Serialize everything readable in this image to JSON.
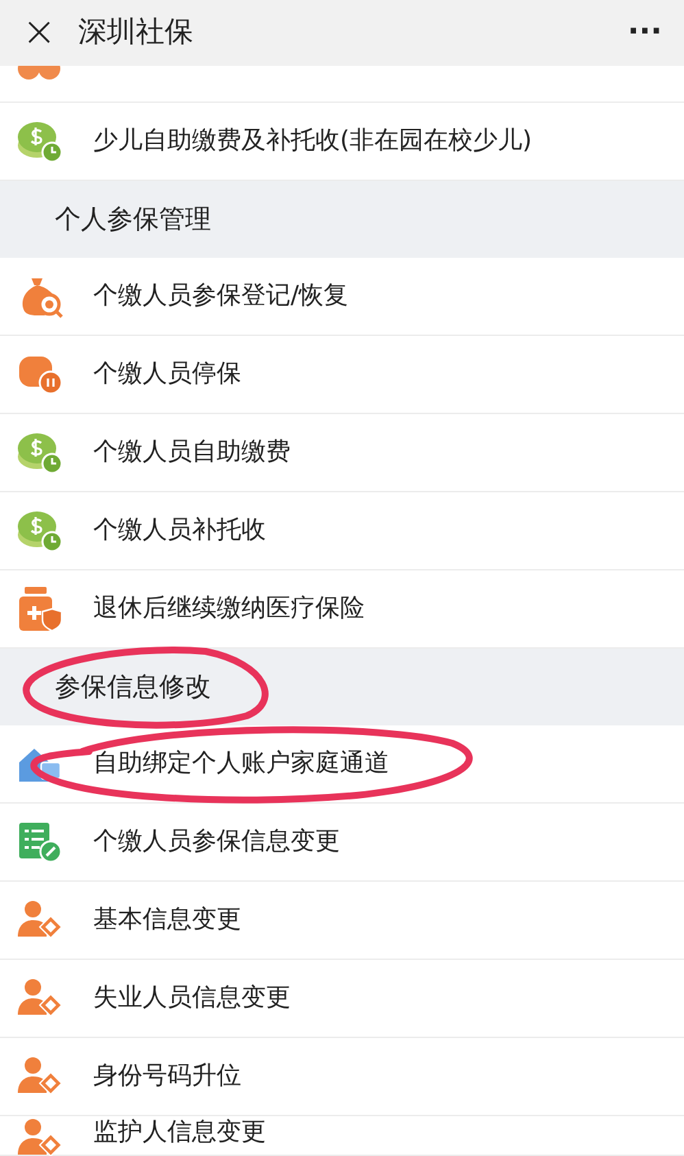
{
  "header": {
    "close": "×",
    "title": "深圳社保",
    "more": "···"
  },
  "sections": [
    {
      "kind": "rows",
      "items": [
        {
          "label": "少儿自助缴费及补托收(非在园在校少儿)"
        }
      ]
    },
    {
      "kind": "section",
      "title": "个人参保管理",
      "items": [
        {
          "label": "个缴人员参保登记/恢复"
        },
        {
          "label": "个缴人员停保"
        },
        {
          "label": "个缴人员自助缴费"
        },
        {
          "label": "个缴人员补托收"
        },
        {
          "label": "退休后继续缴纳医疗保险"
        }
      ]
    },
    {
      "kind": "section",
      "title": "参保信息修改",
      "items": [
        {
          "label": "自助绑定个人账户家庭通道"
        },
        {
          "label": "个缴人员参保信息变更"
        },
        {
          "label": "基本信息变更"
        },
        {
          "label": "失业人员信息变更"
        },
        {
          "label": "身份号码升位"
        },
        {
          "label": "监护人信息变更"
        }
      ]
    }
  ]
}
